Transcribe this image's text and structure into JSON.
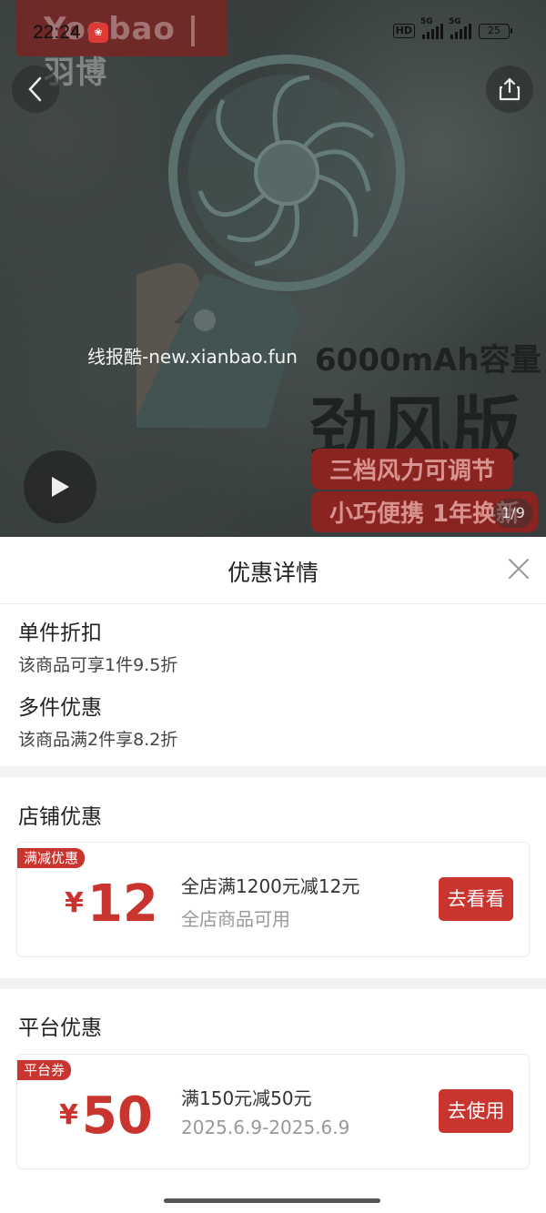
{
  "status_bar": {
    "time": "22:24",
    "hd": "HD",
    "net1": "5G",
    "net2": "5G",
    "battery": "25"
  },
  "hero": {
    "brand": "Yoobao | 羽博",
    "watermark": "线报酷-new.xianbao.fun",
    "ad_capacity": "6000mAh容量",
    "ad_headline": "劲风版",
    "ad_pill_1": "三档风力可调节",
    "ad_pill_2": "小巧便携 1年换新",
    "page_indicator": "1/9",
    "icons": {
      "back": "chevron-left-icon",
      "share": "share-icon",
      "play": "play-icon"
    }
  },
  "sheet": {
    "title": "优惠详情",
    "discounts": [
      {
        "title": "单件折扣",
        "desc": "该商品可享1件9.5折"
      },
      {
        "title": "多件优惠",
        "desc": "该商品满2件享8.2折"
      }
    ],
    "store_section": {
      "title": "店铺优惠",
      "coupon": {
        "tag": "满减优惠",
        "currency": "¥",
        "amount": "12",
        "main": "全店满1200元减12元",
        "sub": "全店商品可用",
        "button": "去看看"
      }
    },
    "platform_section": {
      "title": "平台优惠",
      "coupon": {
        "tag": "平台券",
        "currency": "¥",
        "amount": "50",
        "main": "满150元减50元",
        "sub": "2025.6.9-2025.6.9",
        "button": "去使用"
      }
    }
  },
  "colors": {
    "accent": "#c9342f",
    "divider": "#ececec",
    "band": "#f2f2f2"
  }
}
